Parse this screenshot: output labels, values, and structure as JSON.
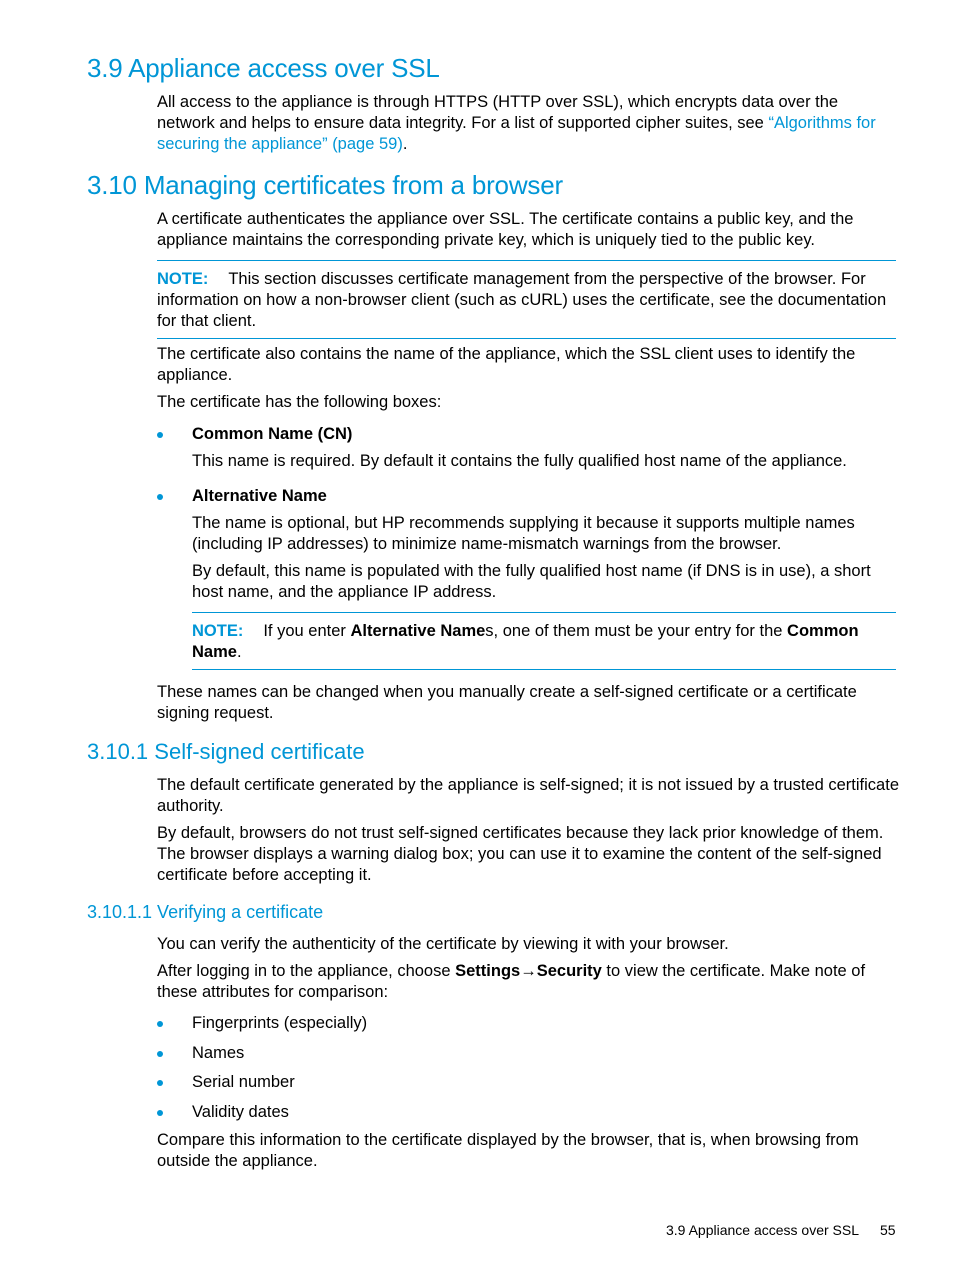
{
  "sections": {
    "s39": {
      "title": "3.9 Appliance access over SSL",
      "para_prefix": "All access to the appliance is through HTTPS (HTTP over SSL), which encrypts data over the network and helps to ensure data integrity. For a list of supported cipher suites, see ",
      "link": "“Algorithms for securing the appliance” (page 59)",
      "para_suffix": "."
    },
    "s310": {
      "title": "3.10 Managing certificates from a browser",
      "para1": "A certificate authenticates the appliance over SSL. The certificate contains a public key, and the appliance maintains the corresponding private key, which is uniquely tied to the public key.",
      "note_label": "NOTE:",
      "note_text": "This section discusses certificate management from the perspective of the browser. For information on how a non-browser client (such as cURL) uses the certificate, see the documentation for that client.",
      "para2": "The certificate also contains the name of the appliance, which the SSL client uses to identify the appliance.",
      "para3": "The certificate has the following boxes:",
      "boxes": [
        {
          "name": "Common Name (CN)",
          "paras": [
            "This name is required. By default it contains the fully qualified host name of the appliance."
          ]
        },
        {
          "name": "Alternative Name",
          "paras": [
            "The name is optional, but HP recommends supplying it because it supports multiple names (including IP addresses) to minimize name-mismatch warnings from the browser.",
            "By default, this name is populated with the fully qualified host name (if DNS is in use), a short host name, and the appliance IP address."
          ]
        }
      ],
      "note2_label": "NOTE:",
      "note2_pre": "If you enter ",
      "note2_b1": "Alternative Name",
      "note2_mid": "s, one of them must be your entry for the ",
      "note2_b2": "Common Name",
      "note2_end": ".",
      "para4": "These names can be changed when you manually create a self-signed certificate or a certificate signing request."
    },
    "s3101": {
      "title": "3.10.1 Self-signed certificate",
      "para1": "The default certificate generated by the appliance is self-signed; it is not issued by a trusted certificate authority.",
      "para2": "By default, browsers do not trust self-signed certificates because they lack prior knowledge of them. The browser displays a warning dialog box; you can use it to examine the content of the self-signed certificate before accepting it."
    },
    "s31011": {
      "title": "3.10.1.1 Verifying a certificate",
      "para1": "You can verify the authenticity of the certificate by viewing it with your browser.",
      "para2_pre": "After logging in to the appliance, choose ",
      "para2_b1": "Settings",
      "para2_arrow": "→",
      "para2_b2": "Security",
      "para2_post": " to view the certificate. Make note of these attributes for comparison:",
      "attributes": [
        "Fingerprints (especially)",
        "Names",
        "Serial number",
        "Validity dates"
      ],
      "para3": "Compare this information to the certificate displayed by the browser, that is, when browsing from outside the appliance."
    }
  },
  "footer": {
    "section": "3.9 Appliance access over SSL",
    "page": "55"
  }
}
